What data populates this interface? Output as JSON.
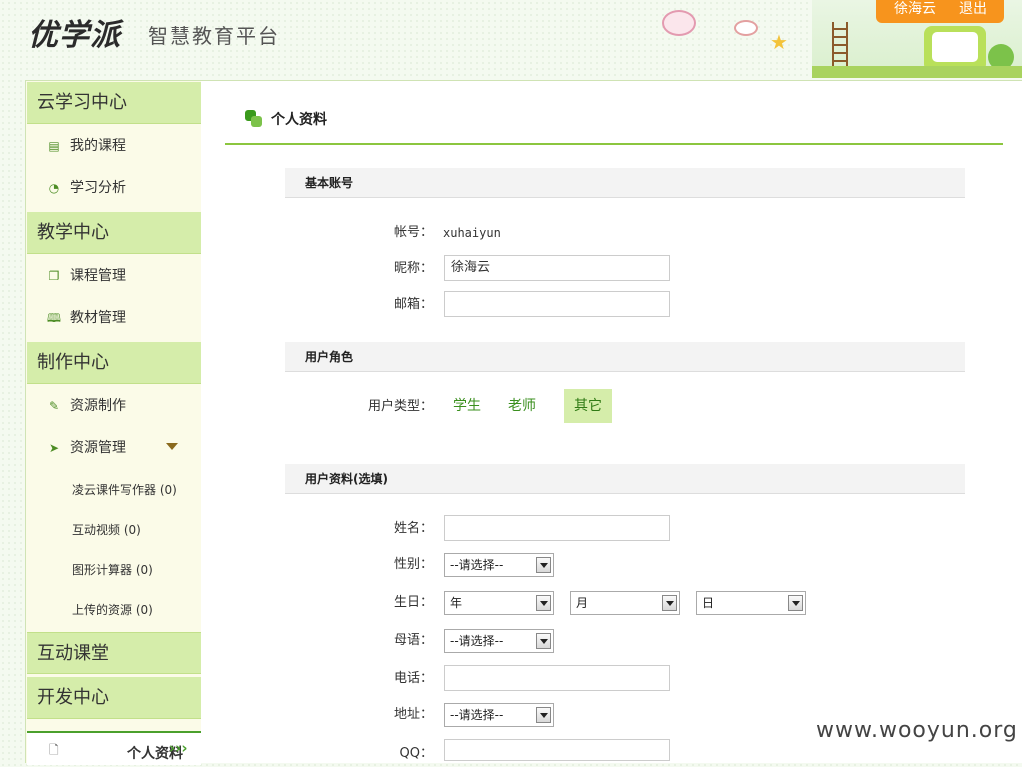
{
  "header": {
    "logo": "优学派",
    "subtitle": "智慧教育平台",
    "user_name": "徐海云",
    "logout": "退出"
  },
  "sidebar": {
    "sections": {
      "cloud": "云学习中心",
      "teach": "教学中心",
      "make": "制作中心",
      "interact": "互动课堂",
      "dev": "开发中心"
    },
    "items": {
      "my_courses": "我的课程",
      "study_analysis": "学习分析",
      "course_manage": "课程管理",
      "material_manage": "教材管理",
      "resource_make": "资源制作",
      "resource_manage": "资源管理"
    },
    "sub_items": [
      "凌云课件写作器 (0)",
      "互动视频 (0)",
      "图形计算器 (0)",
      "上传的资源 (0)"
    ],
    "active": "个人资料",
    "active_arrow": "›››"
  },
  "main": {
    "title": "个人资料",
    "basic": {
      "heading": "基本账号",
      "account_label": "帐号：",
      "account_value": "xuhaiyun",
      "nickname_label": "昵称：",
      "nickname_value": "徐海云",
      "email_label": "邮箱：",
      "email_value": ""
    },
    "role": {
      "heading": "用户角色",
      "type_label": "用户类型：",
      "options": [
        "学生",
        "老师",
        "其它"
      ],
      "selected": "其它"
    },
    "profile": {
      "heading": "用户资料(选填)",
      "name_label": "姓名：",
      "gender_label": "性别：",
      "gender_value": "--请选择--",
      "birthday_label": "生日：",
      "year_value": "年",
      "month_value": "月",
      "day_value": "日",
      "language_label": "母语：",
      "language_value": "--请选择--",
      "phone_label": "电话：",
      "address_label": "地址：",
      "address_value": "--请选择--",
      "qq_label": "QQ："
    }
  },
  "watermark": "www.wooyun.org",
  "colors": {
    "accent_green": "#8cc63f",
    "section_green": "#d5edaa",
    "orange": "#f7941d"
  }
}
